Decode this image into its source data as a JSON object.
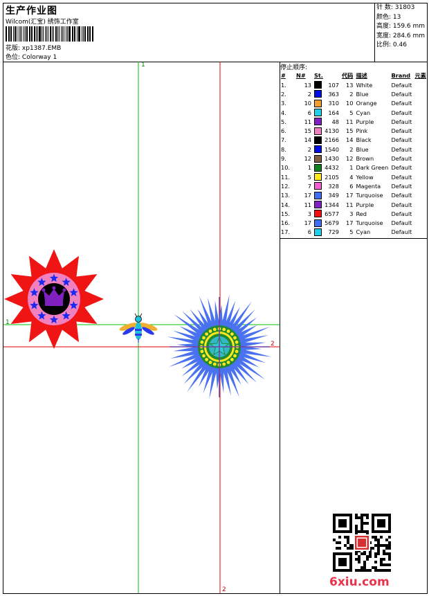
{
  "header": {
    "title": "生产作业图",
    "subtitle": "Wilcom(汇宝) 绣饰工作室",
    "design_label": "花版:",
    "design_value": "xp1387.EMB",
    "colorway_label": "色位:",
    "colorway_value": "Colorway 1"
  },
  "stats": {
    "stitches": "针 数: 31803",
    "colors": "颜色: 13",
    "height": "高度: 159.6 mm",
    "width": "宽度: 284.6 mm",
    "scale": "比例: 0.46"
  },
  "canvas": {
    "axis_top_label": "1",
    "axis_left_label": "1",
    "axis_right_label": "2",
    "axis_bottom_label": "2"
  },
  "panel": {
    "heading": "停止顺序:",
    "columns": [
      "#",
      "N#",
      "St.",
      "代码",
      "描述",
      "Brand",
      "元素"
    ],
    "rows": [
      {
        "idx": "1.",
        "n": "13",
        "color": "#000000",
        "st": "107",
        "code": "13",
        "desc": "White",
        "brand": "Default"
      },
      {
        "idx": "2.",
        "n": "2",
        "color": "#0010e0",
        "st": "363",
        "code": "2",
        "desc": "Blue",
        "brand": "Default"
      },
      {
        "idx": "3.",
        "n": "10",
        "color": "#f0a030",
        "st": "310",
        "code": "10",
        "desc": "Orange",
        "brand": "Default"
      },
      {
        "idx": "4.",
        "n": "6",
        "color": "#20d0e8",
        "st": "164",
        "code": "5",
        "desc": "Cyan",
        "brand": "Default"
      },
      {
        "idx": "5.",
        "n": "11",
        "color": "#8020c0",
        "st": "48",
        "code": "11",
        "desc": "Purple",
        "brand": "Default"
      },
      {
        "idx": "6.",
        "n": "15",
        "color": "#f080c0",
        "st": "4130",
        "code": "15",
        "desc": "Pink",
        "brand": "Default"
      },
      {
        "idx": "7.",
        "n": "14",
        "color": "#000000",
        "st": "2166",
        "code": "14",
        "desc": "Black",
        "brand": "Default"
      },
      {
        "idx": "8.",
        "n": "2",
        "color": "#0010e0",
        "st": "1540",
        "code": "2",
        "desc": "Blue",
        "brand": "Default"
      },
      {
        "idx": "9.",
        "n": "12",
        "color": "#806040",
        "st": "1430",
        "code": "12",
        "desc": "Brown",
        "brand": "Default"
      },
      {
        "idx": "10.",
        "n": "1",
        "color": "#108020",
        "st": "4432",
        "code": "1",
        "desc": "Dark Green",
        "brand": "Default"
      },
      {
        "idx": "11.",
        "n": "5",
        "color": "#ffe820",
        "st": "2105",
        "code": "4",
        "desc": "Yellow",
        "brand": "Default"
      },
      {
        "idx": "12.",
        "n": "7",
        "color": "#f060d0",
        "st": "328",
        "code": "6",
        "desc": "Magenta",
        "brand": "Default"
      },
      {
        "idx": "13.",
        "n": "17",
        "color": "#4070f0",
        "st": "349",
        "code": "17",
        "desc": "Turquoise",
        "brand": "Default"
      },
      {
        "idx": "14.",
        "n": "11",
        "color": "#8020c0",
        "st": "1344",
        "code": "11",
        "desc": "Purple",
        "brand": "Default"
      },
      {
        "idx": "15.",
        "n": "3",
        "color": "#f01010",
        "st": "6577",
        "code": "3",
        "desc": "Red",
        "brand": "Default"
      },
      {
        "idx": "16.",
        "n": "17",
        "color": "#4070f0",
        "st": "5679",
        "code": "17",
        "desc": "Turquoise",
        "brand": "Default"
      },
      {
        "idx": "17.",
        "n": "6",
        "color": "#20d0e8",
        "st": "729",
        "code": "5",
        "desc": "Cyan",
        "brand": "Default"
      }
    ]
  },
  "footer": {
    "watermark": "6xiu.com",
    "qr_icon": "qr-code-icon"
  }
}
